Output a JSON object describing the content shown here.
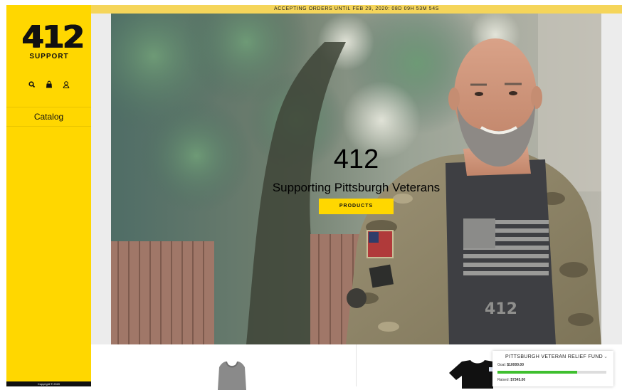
{
  "brand": {
    "logo_number": "412",
    "logo_word": "SUPPORT"
  },
  "sidebar": {
    "icons": [
      "search-icon",
      "bag-icon",
      "user-icon"
    ],
    "nav": [
      {
        "label": "Catalog"
      }
    ],
    "footer": "Copyright © 2020"
  },
  "announcement": {
    "text": "ACCEPTING ORDERS UNTIL FEB 29, 2020: 08D 09H 53M 54S"
  },
  "hero": {
    "title": "412",
    "subtitle": "Supporting Pittsburgh Veterans",
    "button_label": "PRODUCTS"
  },
  "fund": {
    "title": "PITTSBURGH VETERAN RELIEF FUND",
    "goal_label": "Goal:",
    "goal_value": "$10000.00",
    "raised_label": "Raised:",
    "raised_value": "$7345.00",
    "progress": 0.7345
  },
  "colors": {
    "accent": "#ffd700",
    "announce": "#f5d55a",
    "progress": "#3fbf2f"
  }
}
